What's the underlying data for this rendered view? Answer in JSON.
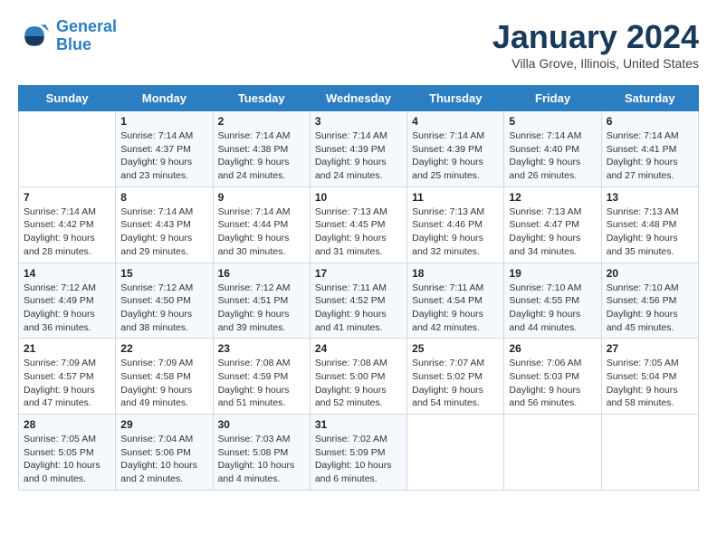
{
  "logo": {
    "line1": "General",
    "line2": "Blue"
  },
  "title": "January 2024",
  "subtitle": "Villa Grove, Illinois, United States",
  "weekdays": [
    "Sunday",
    "Monday",
    "Tuesday",
    "Wednesday",
    "Thursday",
    "Friday",
    "Saturday"
  ],
  "weeks": [
    [
      {
        "day": "",
        "sunrise": "",
        "sunset": "",
        "daylight": ""
      },
      {
        "day": "1",
        "sunrise": "Sunrise: 7:14 AM",
        "sunset": "Sunset: 4:37 PM",
        "daylight": "Daylight: 9 hours and 23 minutes."
      },
      {
        "day": "2",
        "sunrise": "Sunrise: 7:14 AM",
        "sunset": "Sunset: 4:38 PM",
        "daylight": "Daylight: 9 hours and 24 minutes."
      },
      {
        "day": "3",
        "sunrise": "Sunrise: 7:14 AM",
        "sunset": "Sunset: 4:39 PM",
        "daylight": "Daylight: 9 hours and 24 minutes."
      },
      {
        "day": "4",
        "sunrise": "Sunrise: 7:14 AM",
        "sunset": "Sunset: 4:39 PM",
        "daylight": "Daylight: 9 hours and 25 minutes."
      },
      {
        "day": "5",
        "sunrise": "Sunrise: 7:14 AM",
        "sunset": "Sunset: 4:40 PM",
        "daylight": "Daylight: 9 hours and 26 minutes."
      },
      {
        "day": "6",
        "sunrise": "Sunrise: 7:14 AM",
        "sunset": "Sunset: 4:41 PM",
        "daylight": "Daylight: 9 hours and 27 minutes."
      }
    ],
    [
      {
        "day": "7",
        "sunrise": "Sunrise: 7:14 AM",
        "sunset": "Sunset: 4:42 PM",
        "daylight": "Daylight: 9 hours and 28 minutes."
      },
      {
        "day": "8",
        "sunrise": "Sunrise: 7:14 AM",
        "sunset": "Sunset: 4:43 PM",
        "daylight": "Daylight: 9 hours and 29 minutes."
      },
      {
        "day": "9",
        "sunrise": "Sunrise: 7:14 AM",
        "sunset": "Sunset: 4:44 PM",
        "daylight": "Daylight: 9 hours and 30 minutes."
      },
      {
        "day": "10",
        "sunrise": "Sunrise: 7:13 AM",
        "sunset": "Sunset: 4:45 PM",
        "daylight": "Daylight: 9 hours and 31 minutes."
      },
      {
        "day": "11",
        "sunrise": "Sunrise: 7:13 AM",
        "sunset": "Sunset: 4:46 PM",
        "daylight": "Daylight: 9 hours and 32 minutes."
      },
      {
        "day": "12",
        "sunrise": "Sunrise: 7:13 AM",
        "sunset": "Sunset: 4:47 PM",
        "daylight": "Daylight: 9 hours and 34 minutes."
      },
      {
        "day": "13",
        "sunrise": "Sunrise: 7:13 AM",
        "sunset": "Sunset: 4:48 PM",
        "daylight": "Daylight: 9 hours and 35 minutes."
      }
    ],
    [
      {
        "day": "14",
        "sunrise": "Sunrise: 7:12 AM",
        "sunset": "Sunset: 4:49 PM",
        "daylight": "Daylight: 9 hours and 36 minutes."
      },
      {
        "day": "15",
        "sunrise": "Sunrise: 7:12 AM",
        "sunset": "Sunset: 4:50 PM",
        "daylight": "Daylight: 9 hours and 38 minutes."
      },
      {
        "day": "16",
        "sunrise": "Sunrise: 7:12 AM",
        "sunset": "Sunset: 4:51 PM",
        "daylight": "Daylight: 9 hours and 39 minutes."
      },
      {
        "day": "17",
        "sunrise": "Sunrise: 7:11 AM",
        "sunset": "Sunset: 4:52 PM",
        "daylight": "Daylight: 9 hours and 41 minutes."
      },
      {
        "day": "18",
        "sunrise": "Sunrise: 7:11 AM",
        "sunset": "Sunset: 4:54 PM",
        "daylight": "Daylight: 9 hours and 42 minutes."
      },
      {
        "day": "19",
        "sunrise": "Sunrise: 7:10 AM",
        "sunset": "Sunset: 4:55 PM",
        "daylight": "Daylight: 9 hours and 44 minutes."
      },
      {
        "day": "20",
        "sunrise": "Sunrise: 7:10 AM",
        "sunset": "Sunset: 4:56 PM",
        "daylight": "Daylight: 9 hours and 45 minutes."
      }
    ],
    [
      {
        "day": "21",
        "sunrise": "Sunrise: 7:09 AM",
        "sunset": "Sunset: 4:57 PM",
        "daylight": "Daylight: 9 hours and 47 minutes."
      },
      {
        "day": "22",
        "sunrise": "Sunrise: 7:09 AM",
        "sunset": "Sunset: 4:58 PM",
        "daylight": "Daylight: 9 hours and 49 minutes."
      },
      {
        "day": "23",
        "sunrise": "Sunrise: 7:08 AM",
        "sunset": "Sunset: 4:59 PM",
        "daylight": "Daylight: 9 hours and 51 minutes."
      },
      {
        "day": "24",
        "sunrise": "Sunrise: 7:08 AM",
        "sunset": "Sunset: 5:00 PM",
        "daylight": "Daylight: 9 hours and 52 minutes."
      },
      {
        "day": "25",
        "sunrise": "Sunrise: 7:07 AM",
        "sunset": "Sunset: 5:02 PM",
        "daylight": "Daylight: 9 hours and 54 minutes."
      },
      {
        "day": "26",
        "sunrise": "Sunrise: 7:06 AM",
        "sunset": "Sunset: 5:03 PM",
        "daylight": "Daylight: 9 hours and 56 minutes."
      },
      {
        "day": "27",
        "sunrise": "Sunrise: 7:05 AM",
        "sunset": "Sunset: 5:04 PM",
        "daylight": "Daylight: 9 hours and 58 minutes."
      }
    ],
    [
      {
        "day": "28",
        "sunrise": "Sunrise: 7:05 AM",
        "sunset": "Sunset: 5:05 PM",
        "daylight": "Daylight: 10 hours and 0 minutes."
      },
      {
        "day": "29",
        "sunrise": "Sunrise: 7:04 AM",
        "sunset": "Sunset: 5:06 PM",
        "daylight": "Daylight: 10 hours and 2 minutes."
      },
      {
        "day": "30",
        "sunrise": "Sunrise: 7:03 AM",
        "sunset": "Sunset: 5:08 PM",
        "daylight": "Daylight: 10 hours and 4 minutes."
      },
      {
        "day": "31",
        "sunrise": "Sunrise: 7:02 AM",
        "sunset": "Sunset: 5:09 PM",
        "daylight": "Daylight: 10 hours and 6 minutes."
      },
      {
        "day": "",
        "sunrise": "",
        "sunset": "",
        "daylight": ""
      },
      {
        "day": "",
        "sunrise": "",
        "sunset": "",
        "daylight": ""
      },
      {
        "day": "",
        "sunrise": "",
        "sunset": "",
        "daylight": ""
      }
    ]
  ]
}
